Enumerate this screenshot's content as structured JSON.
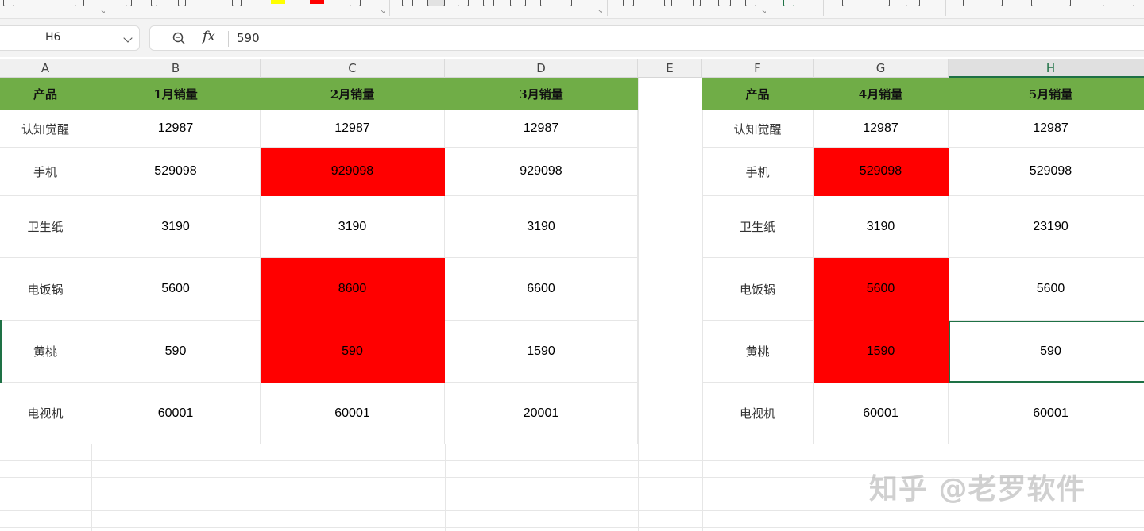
{
  "formula_bar": {
    "cell_ref": "H6",
    "fx_label": "fx",
    "value": "590"
  },
  "columns": [
    "A",
    "B",
    "C",
    "D",
    "E",
    "F",
    "G",
    "H"
  ],
  "selected_column": "H",
  "table1": {
    "headers": [
      "产品",
      "1月销量",
      "2月销量",
      "3月销量"
    ],
    "rows": [
      [
        "认知觉醒",
        "12987",
        "12987",
        "12987"
      ],
      [
        "手机",
        "529098",
        "929098",
        "929098"
      ],
      [
        "卫生纸",
        "3190",
        "3190",
        "3190"
      ],
      [
        "电饭锅",
        "5600",
        "8600",
        "6600"
      ],
      [
        "黄桃",
        "590",
        "590",
        "1590"
      ],
      [
        "电视机",
        "60001",
        "60001",
        "20001"
      ]
    ]
  },
  "table2": {
    "headers": [
      "产品",
      "4月销量",
      "5月销量"
    ],
    "rows": [
      [
        "认知觉醒",
        "12987",
        "12987"
      ],
      [
        "手机",
        "529098",
        "529098"
      ],
      [
        "卫生纸",
        "3190",
        "23190"
      ],
      [
        "电饭锅",
        "5600",
        "5600"
      ],
      [
        "黄桃",
        "1590",
        "590"
      ],
      [
        "电视机",
        "60001",
        "60001"
      ]
    ]
  },
  "colors": {
    "header_fill": "#70ad47",
    "highlight_fill": "#ff0000",
    "selection": "#1e7145"
  },
  "icons": [
    "zoom-icon",
    "fx-icon",
    "dropdown-arrow-icon"
  ],
  "watermark": "知乎 @老罗软件"
}
